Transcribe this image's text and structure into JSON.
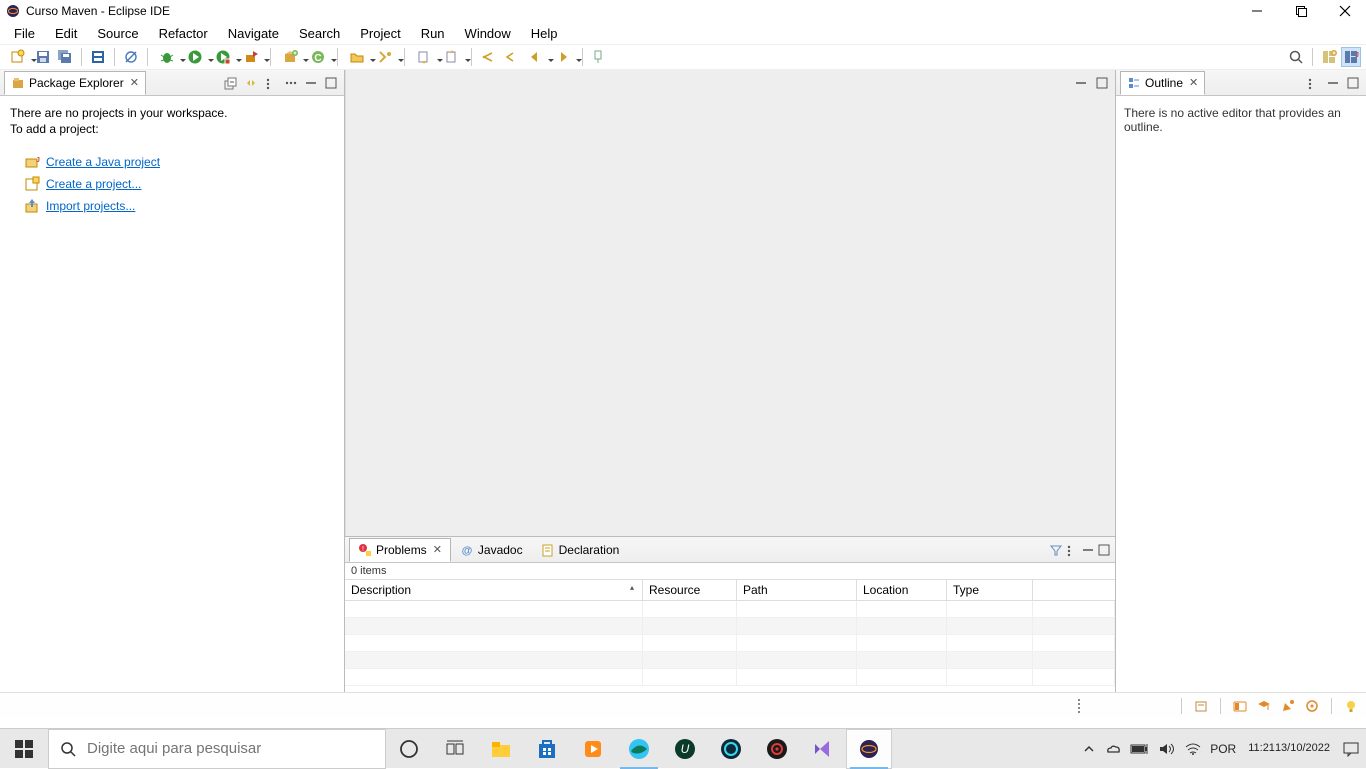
{
  "title": "Curso Maven - Eclipse IDE",
  "menu": [
    "File",
    "Edit",
    "Source",
    "Refactor",
    "Navigate",
    "Search",
    "Project",
    "Run",
    "Window",
    "Help"
  ],
  "package_explorer": {
    "tab_label": "Package Explorer",
    "hint1": "There are no projects in your workspace.",
    "hint2": "To add a project:",
    "links": {
      "create_java": "Create a Java project",
      "create_project": "Create a project...",
      "import": "Import projects..."
    }
  },
  "outline": {
    "tab_label": "Outline",
    "body": "There is no active editor that provides an outline."
  },
  "bottom": {
    "tabs": {
      "problems": "Problems",
      "javadoc": "Javadoc",
      "declaration": "Declaration"
    },
    "items_count": "0 items",
    "columns": {
      "description": "Description",
      "resource": "Resource",
      "path": "Path",
      "location": "Location",
      "type": "Type"
    }
  },
  "taskbar": {
    "search_placeholder": "Digite aqui para pesquisar",
    "lang": "POR",
    "time": "11:21",
    "date": "13/10/2022"
  }
}
